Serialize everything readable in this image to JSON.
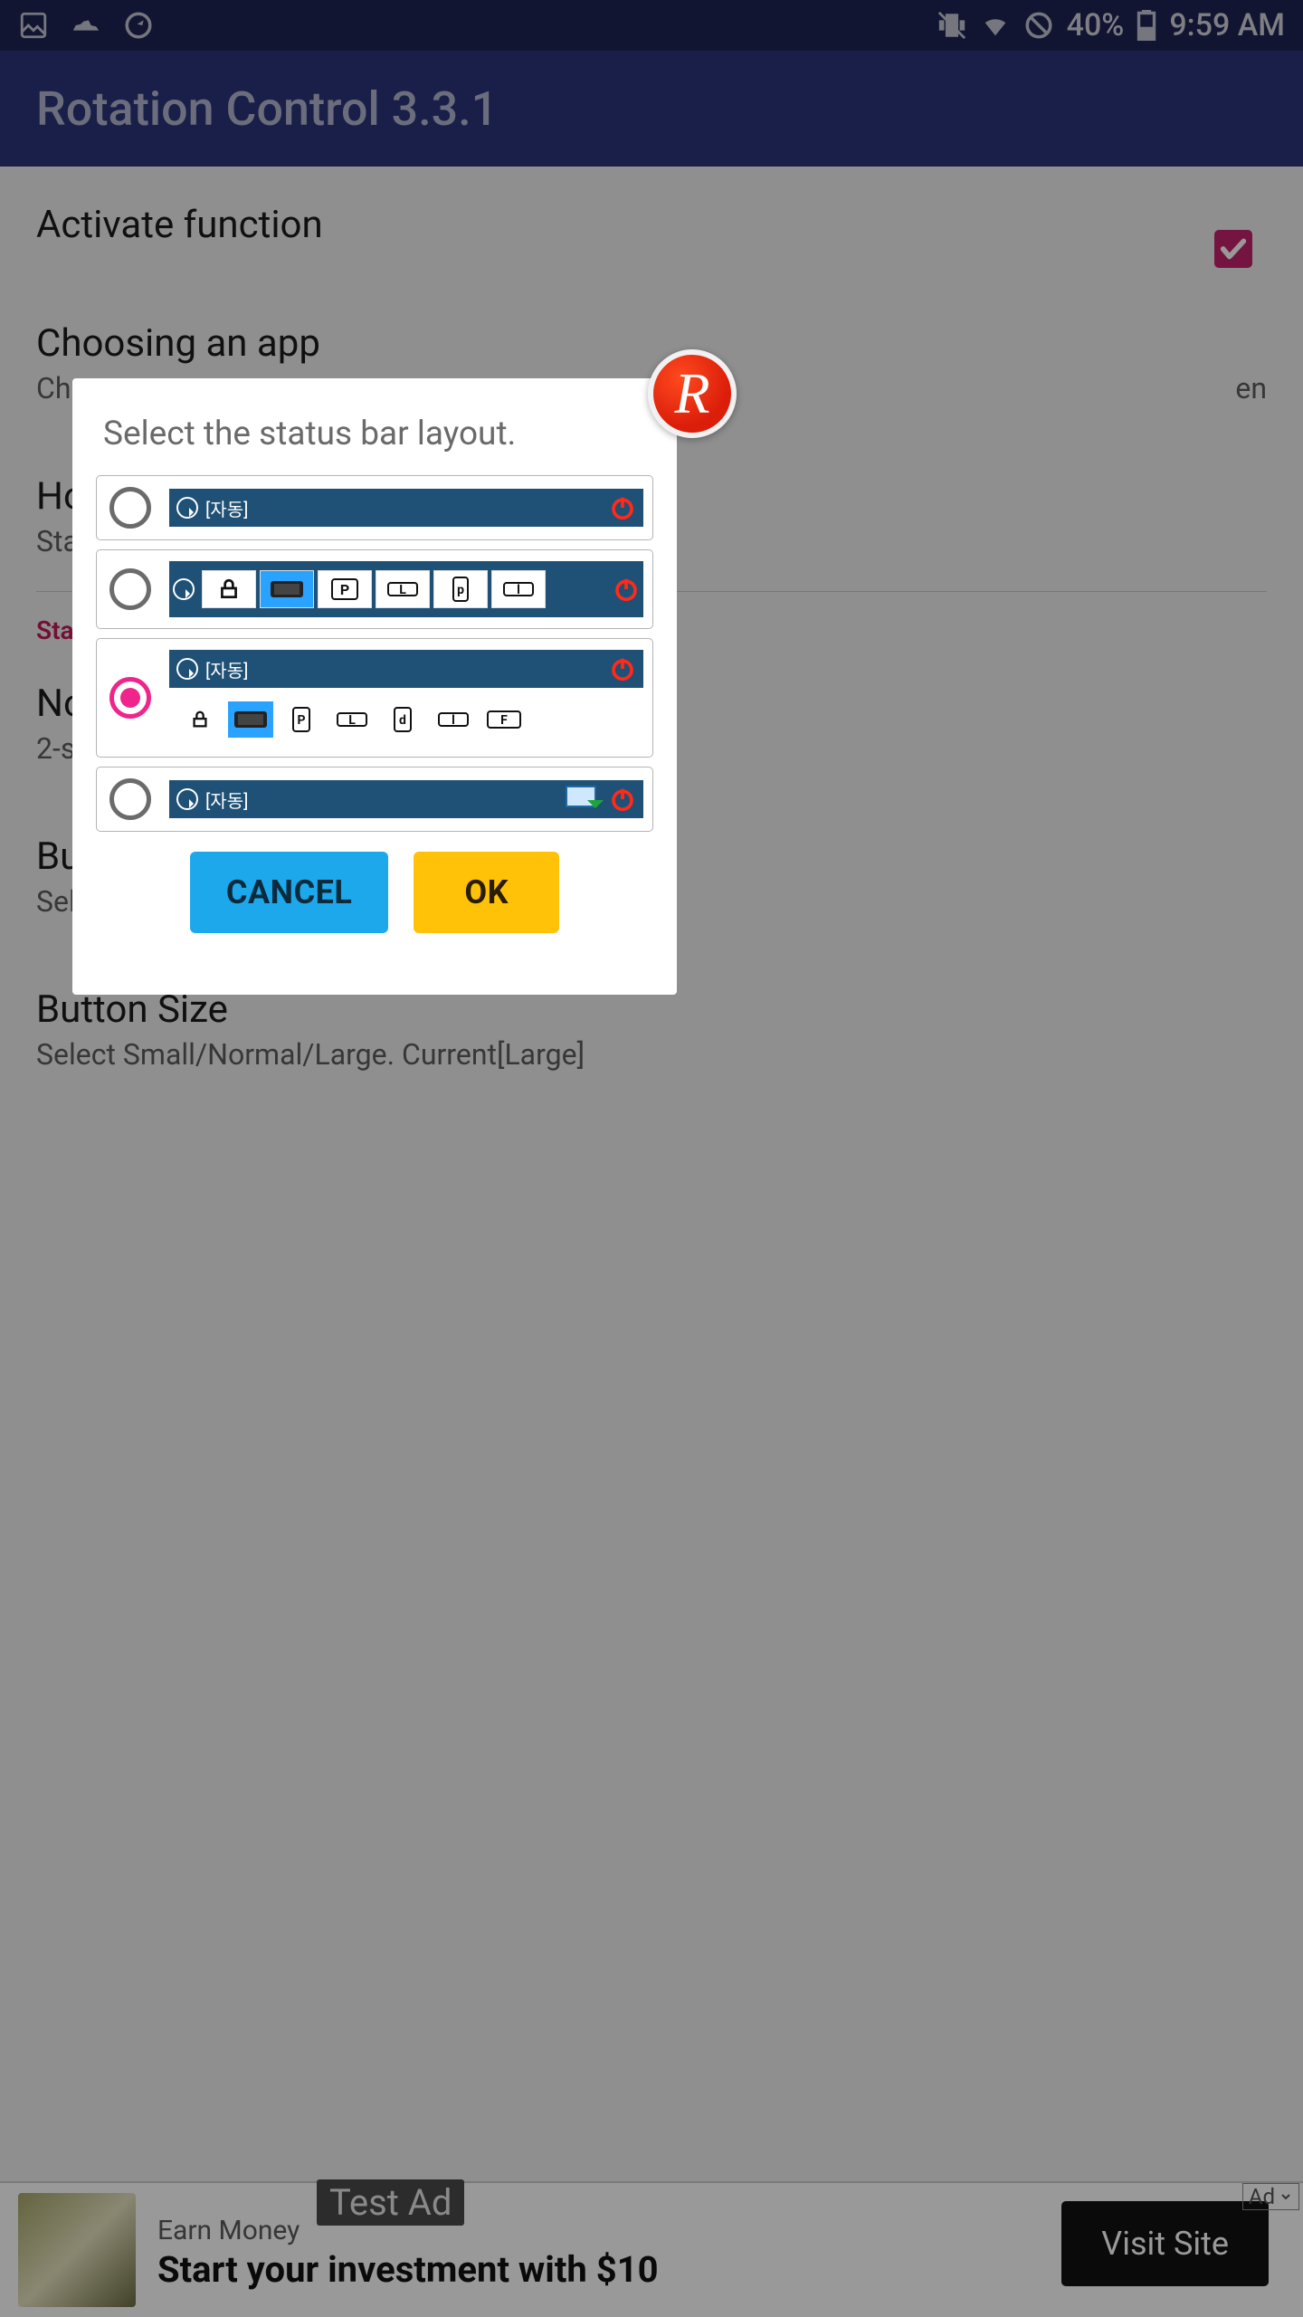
{
  "statusbar": {
    "battery": "40%",
    "time": "9:59 AM"
  },
  "header": {
    "title": "Rotation Control 3.3.1"
  },
  "settings": {
    "activate": {
      "title": "Activate function",
      "checked": true
    },
    "choosing": {
      "title": "Choosing an app",
      "sub_left": "Ch",
      "sub_right": "en"
    },
    "holding": {
      "title_prefix": "Ho",
      "sub_prefix": "Sta"
    },
    "section_prefix": "Sta",
    "notif_group": {
      "title_prefix": "No",
      "sub_prefix": "2-s"
    },
    "button_group1": {
      "title_prefix": "Bu",
      "sub_prefix": "Sel"
    },
    "button_size": {
      "title": "Button Size",
      "sub": "Select Small/Normal/Large. Current[Large]"
    }
  },
  "dialog": {
    "title": "Select the status bar layout.",
    "auto_label": "[자동]",
    "cancel": "CANCEL",
    "ok": "OK",
    "selected_index": 2,
    "row2_labels": [
      "P",
      "L",
      "p",
      "l"
    ],
    "row3_labels": [
      "P",
      "L",
      "d",
      "l",
      "F"
    ],
    "badge": "R"
  },
  "ad": {
    "small": "Earn Money",
    "big": "Start your investment with $10",
    "test": "Test Ad",
    "visit": "Visit Site",
    "flag": "Ad"
  }
}
